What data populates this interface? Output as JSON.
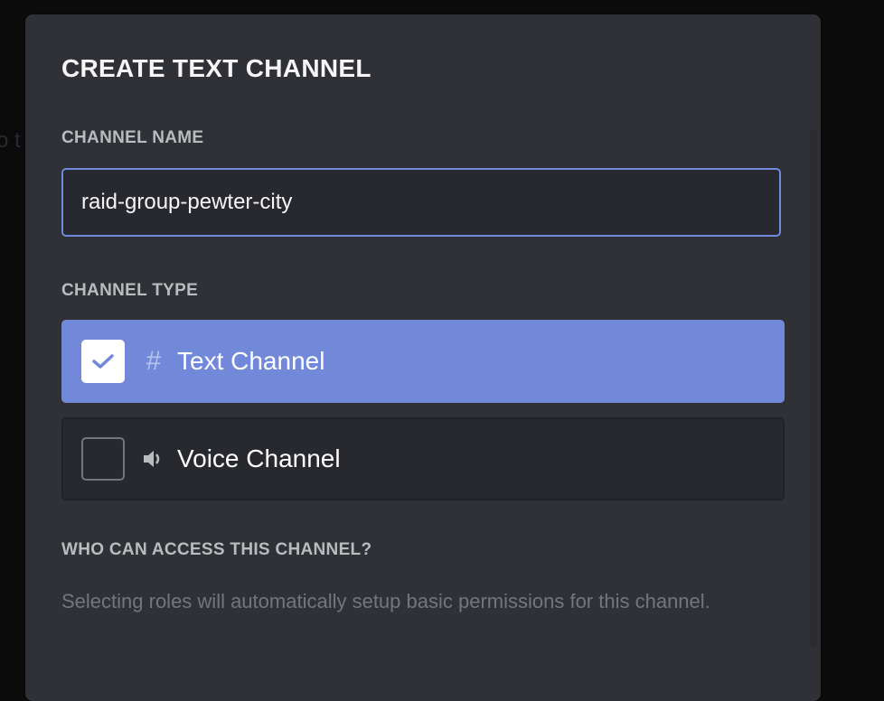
{
  "background": {
    "partial_text": "o t"
  },
  "modal": {
    "title": "CREATE TEXT CHANNEL",
    "channel_name": {
      "label": "CHANNEL NAME",
      "value": "raid-group-pewter-city"
    },
    "channel_type": {
      "label": "CHANNEL TYPE",
      "options": [
        {
          "label": "Text Channel",
          "icon": "hash-icon",
          "selected": true
        },
        {
          "label": "Voice Channel",
          "icon": "speaker-icon",
          "selected": false
        }
      ]
    },
    "access": {
      "label": "WHO CAN ACCESS THIS CHANNEL?",
      "description": "Selecting roles will automatically setup basic permissions for this channel."
    }
  },
  "colors": {
    "accent": "#7289da",
    "modal_bg": "#2f3136",
    "input_bg": "#28292e"
  }
}
